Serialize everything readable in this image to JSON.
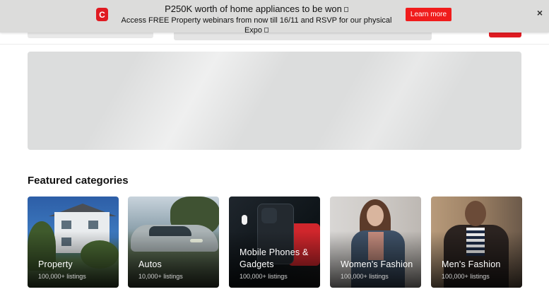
{
  "promo": {
    "logo_letter": "C",
    "title": "P250K worth of home appliances to be won",
    "subtitle": "Access FREE Property webinars from now till 16/11 and RSVP for our physical Expo",
    "cta": "Learn more",
    "close": "×"
  },
  "featured": {
    "heading": "Featured categories",
    "categories": [
      {
        "label": "Property",
        "count": "100,000+ listings"
      },
      {
        "label": "Autos",
        "count": "10,000+ listings"
      },
      {
        "label": "Mobile Phones & Gadgets",
        "count": "100,000+ listings"
      },
      {
        "label": "Women's Fashion",
        "count": "100,000+ listings"
      },
      {
        "label": "Men's Fashion",
        "count": "100,000+ listings"
      }
    ]
  },
  "colors": {
    "brand_red": "#e01b22",
    "cta_red": "#f01c1c",
    "banner_bg": "#dcdcdb"
  }
}
